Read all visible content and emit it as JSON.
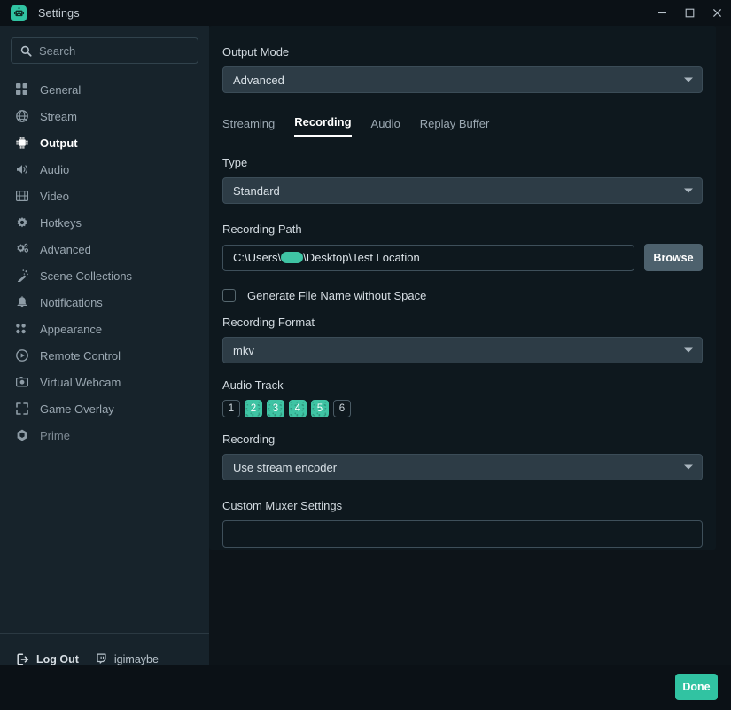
{
  "window": {
    "title": "Settings",
    "app_icon": "robot-app-icon",
    "controls": {
      "minimize": "minimize-icon",
      "maximize": "maximize-icon",
      "close": "close-icon"
    }
  },
  "sidebar": {
    "search": {
      "placeholder": "Search",
      "value": "",
      "icon": "search-icon"
    },
    "items": [
      {
        "label": "General",
        "icon": "grid-icon",
        "active": false
      },
      {
        "label": "Stream",
        "icon": "globe-icon",
        "active": false
      },
      {
        "label": "Output",
        "icon": "chip-icon",
        "active": true
      },
      {
        "label": "Audio",
        "icon": "speaker-icon",
        "active": false
      },
      {
        "label": "Video",
        "icon": "film-icon",
        "active": false
      },
      {
        "label": "Hotkeys",
        "icon": "gear-icon",
        "active": false
      },
      {
        "label": "Advanced",
        "icon": "gears-icon",
        "active": false
      },
      {
        "label": "Scene Collections",
        "icon": "magic-wand-icon",
        "active": false
      },
      {
        "label": "Notifications",
        "icon": "bell-icon",
        "active": false
      },
      {
        "label": "Appearance",
        "icon": "dots-grid-icon",
        "active": false
      },
      {
        "label": "Remote Control",
        "icon": "play-circle-icon",
        "active": false
      },
      {
        "label": "Virtual Webcam",
        "icon": "camera-icon",
        "active": false
      },
      {
        "label": "Game Overlay",
        "icon": "expand-icon",
        "active": false
      },
      {
        "label": "Prime",
        "icon": "prime-diamond-icon",
        "active": false
      }
    ],
    "footer": {
      "logout_label": "Log Out",
      "logout_icon": "logout-icon",
      "account_name": "igimaybe",
      "account_icon": "twitch-icon"
    }
  },
  "main": {
    "output_mode": {
      "label": "Output Mode",
      "value": "Advanced"
    },
    "tabs": [
      {
        "label": "Streaming",
        "active": false
      },
      {
        "label": "Recording",
        "active": true
      },
      {
        "label": "Audio",
        "active": false
      },
      {
        "label": "Replay Buffer",
        "active": false
      }
    ],
    "type": {
      "label": "Type",
      "value": "Standard"
    },
    "recording_path": {
      "label": "Recording Path",
      "value_prefix": "C:\\Users\\",
      "value_suffix": "\\Desktop\\Test Location",
      "redacted": true,
      "browse_label": "Browse"
    },
    "generate_file_name": {
      "label": "Generate File Name without Space",
      "checked": false
    },
    "recording_format": {
      "label": "Recording Format",
      "value": "mkv"
    },
    "audio_track": {
      "label": "Audio Track",
      "tracks": [
        {
          "number": "1",
          "selected": false
        },
        {
          "number": "2",
          "selected": true
        },
        {
          "number": "3",
          "selected": true
        },
        {
          "number": "4",
          "selected": true
        },
        {
          "number": "5",
          "selected": true
        },
        {
          "number": "6",
          "selected": false
        }
      ]
    },
    "recording_encoder": {
      "label": "Recording",
      "value": "Use stream encoder"
    },
    "custom_muxer": {
      "label": "Custom Muxer Settings",
      "value": "",
      "placeholder": ""
    }
  },
  "bottom": {
    "done_label": "Done"
  },
  "colors": {
    "accent": "#31c3a2",
    "track_on": "#3fc4a4",
    "panel_bg": "#0e181e",
    "sidebar_bg": "#17232b"
  }
}
